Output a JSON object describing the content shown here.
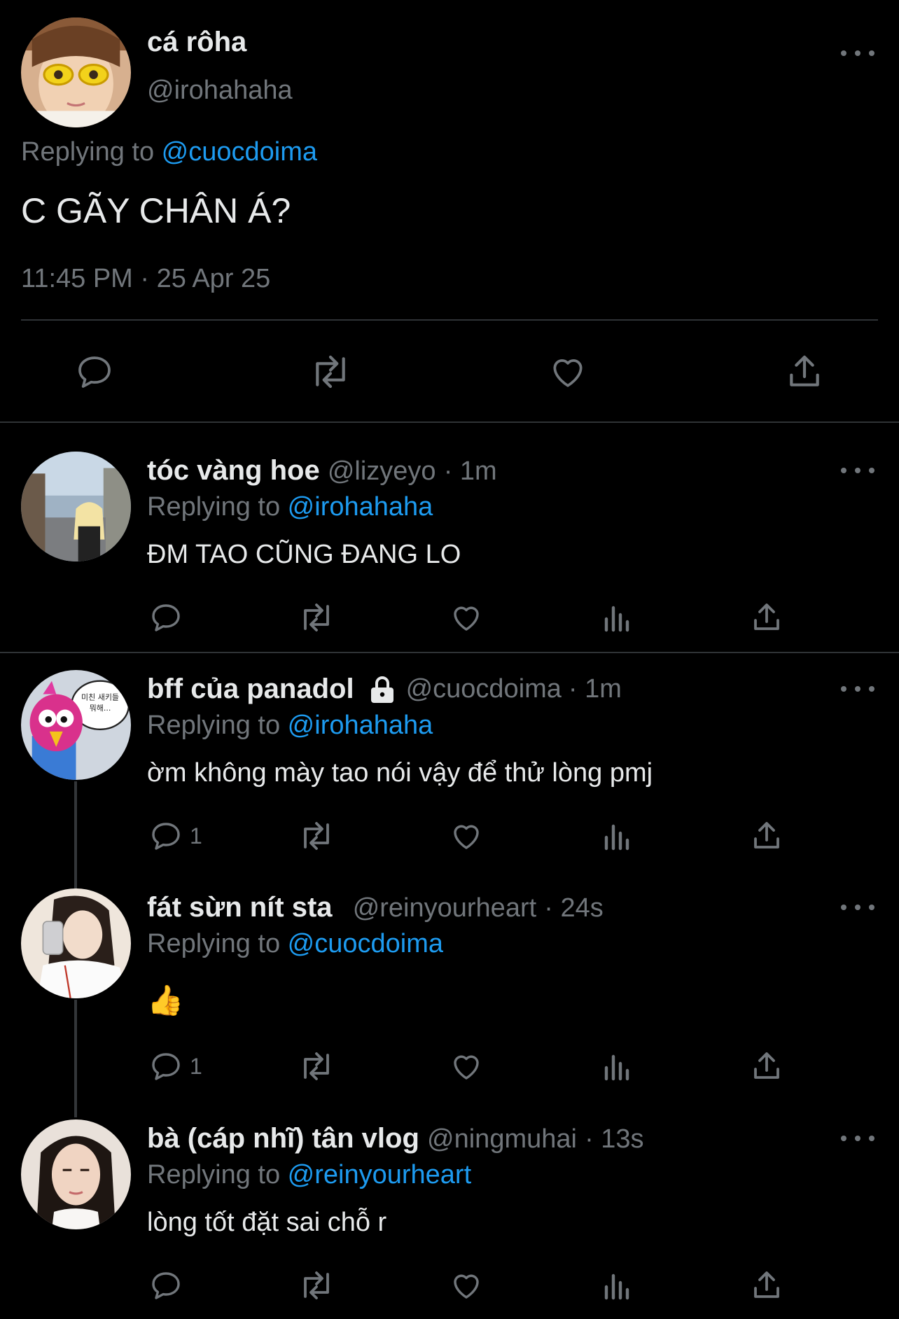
{
  "main_tweet": {
    "display_name": "cá rôha",
    "handle": "@irohahaha",
    "replying_prefix": "Replying to ",
    "replying_to": "@cuocdoima",
    "text": "C GÃY CHÂN Á?",
    "timestamp": "11:45 PM · 25 Apr 25",
    "avatar_colors": {
      "bg": "#c98e63",
      "accent": "#f2d21b"
    }
  },
  "replies": [
    {
      "display_name": "tóc vàng hoe",
      "handle": "@lizyeyo",
      "time": "· 1m",
      "replying_prefix": "Replying to ",
      "replying_to": "@irohahaha",
      "text": "ĐM TAO CŨNG ĐANG LO",
      "reply_count": ""
    },
    {
      "display_name": "bff của panadol",
      "handle": "@cuocdoima",
      "time": "· 1m",
      "replying_prefix": "Replying to ",
      "replying_to": "@irohahaha",
      "text": "ờm không mày tao nói vậy để thử lòng pmj",
      "reply_count": "1",
      "avatar_bubble_text": "미친 새키들 뭐해..."
    },
    {
      "display_name": "fát sừn nít sta",
      "handle": "@reinyourheart",
      "time": "· 24s",
      "replying_prefix": "Replying to ",
      "replying_to": "@cuocdoima",
      "text": "👍",
      "reply_count": "1"
    },
    {
      "display_name": "bà (cáp nhĩ) tân vlog",
      "handle": "@ningmuhai",
      "time": "· 13s",
      "replying_prefix": "Replying to ",
      "replying_to": "@reinyourheart",
      "text": "lòng tốt đặt sai chỗ r",
      "reply_count": ""
    }
  ],
  "colors": {
    "background": "#000000",
    "text": "#e7e9ea",
    "muted": "#71767b",
    "link": "#1d9bf0",
    "divider": "#2f3336"
  }
}
